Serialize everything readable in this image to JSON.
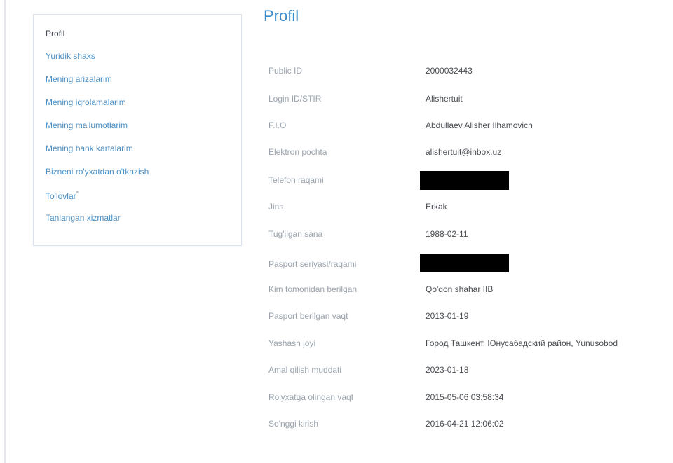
{
  "sidebar": {
    "items": [
      {
        "label": "Profil",
        "active": true
      },
      {
        "label": "Yuridik shaxs"
      },
      {
        "label": "Mening arizalarim"
      },
      {
        "label": "Mening iqrolamalarim"
      },
      {
        "label": "Mening ma'lumotlarim"
      },
      {
        "label": "Mening bank kartalarim"
      },
      {
        "label": "Bizneni ro'yxatdan o'tkazish"
      },
      {
        "label": "To'lovlar",
        "badge": "*"
      },
      {
        "label": "Tanlangan xizmatlar"
      }
    ]
  },
  "main": {
    "title": "Profil",
    "fields": [
      {
        "label": "Public ID",
        "value": "2000032443"
      },
      {
        "label": "Login ID/STIR",
        "value": "Alishertuit"
      },
      {
        "label": "F.I.O",
        "value": "Abdullaev Alisher Ilhamovich"
      },
      {
        "label": "Elektron pochta",
        "value": "alishertuit@inbox.uz"
      },
      {
        "label": "Telefon raqami",
        "value": "",
        "redacted": true
      },
      {
        "label": "Jins",
        "value": "Erkak"
      },
      {
        "label": "Tug'ilgan sana",
        "value": "1988-02-11"
      },
      {
        "label": "Pasport seriyasi/raqami",
        "value": "",
        "redacted": true
      },
      {
        "label": "Kim tomonidan berilgan",
        "value": "Qo'qon shahar IIB"
      },
      {
        "label": "Pasport berilgan vaqt",
        "value": "2013-01-19"
      },
      {
        "label": "Yashash joyi",
        "value": "Город Ташкент, Юнусабадский район, Yunusobod"
      },
      {
        "label": "Amal qilish muddati",
        "value": "2023-01-18"
      },
      {
        "label": "Ro'yxatga olingan vaqt",
        "value": "2015-05-06 03:58:34"
      },
      {
        "label": "So'nggi kirish",
        "value": "2016-04-21 12:06:02"
      }
    ]
  },
  "colors": {
    "link": "#4a8fc4",
    "title": "#3a8dcf",
    "label": "#9aa3ad",
    "value": "#4a4e54",
    "redaction": "#000000"
  }
}
